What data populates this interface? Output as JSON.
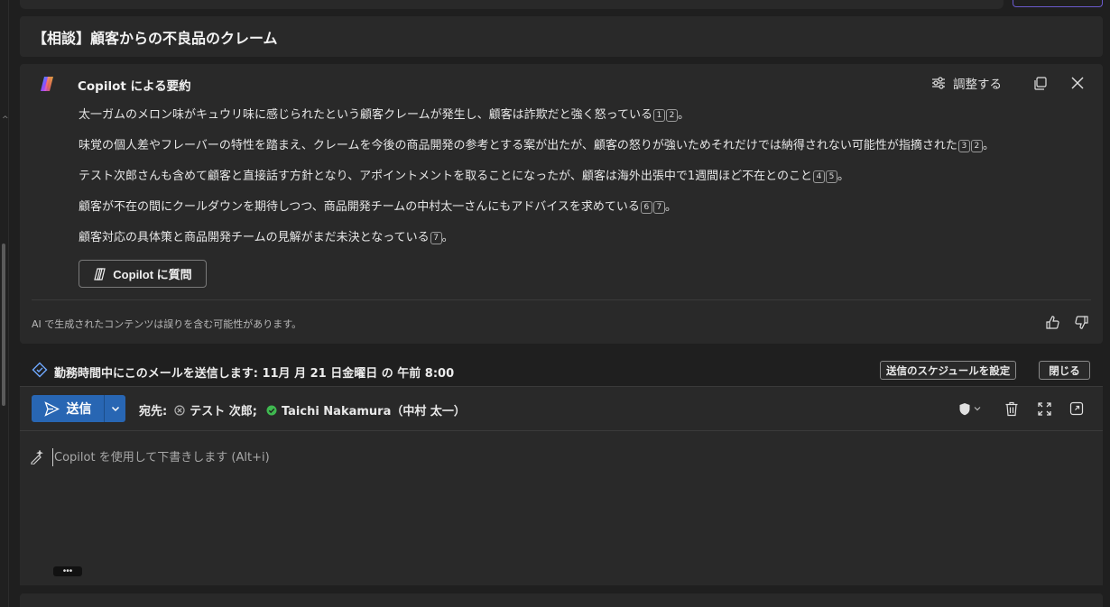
{
  "message": {
    "subject": "【相談】顧客からの不良品のクレーム"
  },
  "summary": {
    "title": "Copilot による要約",
    "adjust_label": "調整する",
    "lines": [
      {
        "text": "太一ガムのメロン味がキュウリ味に感じられたという顧客クレームが発生し、顧客は詐欺だと強く怒っている",
        "cites": [
          "1",
          "2"
        ],
        "suffix": "。"
      },
      {
        "text": "味覚の個人差やフレーバーの特性を踏まえ、クレームを今後の商品開発の参考とする案が出たが、顧客の怒りが強いためそれだけでは納得されない可能性が指摘された",
        "cites": [
          "3",
          "2"
        ],
        "suffix": "。"
      },
      {
        "text": "テスト次郎さんも含めて顧客と直接話す方針となり、アポイントメントを取ることになったが、顧客は海外出張中で1週間ほど不在とのこと",
        "cites": [
          "4",
          "5"
        ],
        "suffix": "。"
      },
      {
        "text": "顧客が不在の間にクールダウンを期待しつつ、商品開発チームの中村太一さんにもアドバイスを求めている",
        "cites": [
          "6",
          "7"
        ],
        "suffix": "。"
      },
      {
        "text": "顧客対応の具体策と商品開発チームの見解がまだ未決となっている",
        "cites": [
          "7"
        ],
        "suffix": "。"
      }
    ],
    "ask_label": "Copilot に質問",
    "disclaimer": "AI で生成されたコンテンツは誤りを含む可能性があります。"
  },
  "schedule": {
    "text": "勤務時間中にこのメールを送信します: 11月 月 21 日金曜日 の 午前 8:00",
    "set_schedule_label": "送信のスケジュールを設定",
    "close_label": "閉じる"
  },
  "compose": {
    "send_label": "送信",
    "to_label": "宛先:",
    "recipients": [
      {
        "name": "テスト 次郎;",
        "status": "offline"
      },
      {
        "name": "Taichi Nakamura（中村 太一）",
        "status": "available"
      }
    ],
    "draft_placeholder": "Copilot を使用して下書きします (Alt+i)",
    "more_label": "•••"
  },
  "colors": {
    "accent": "#2866b3",
    "available": "#3fb950",
    "offline": "#9a9a9a",
    "panel": "#292929"
  }
}
